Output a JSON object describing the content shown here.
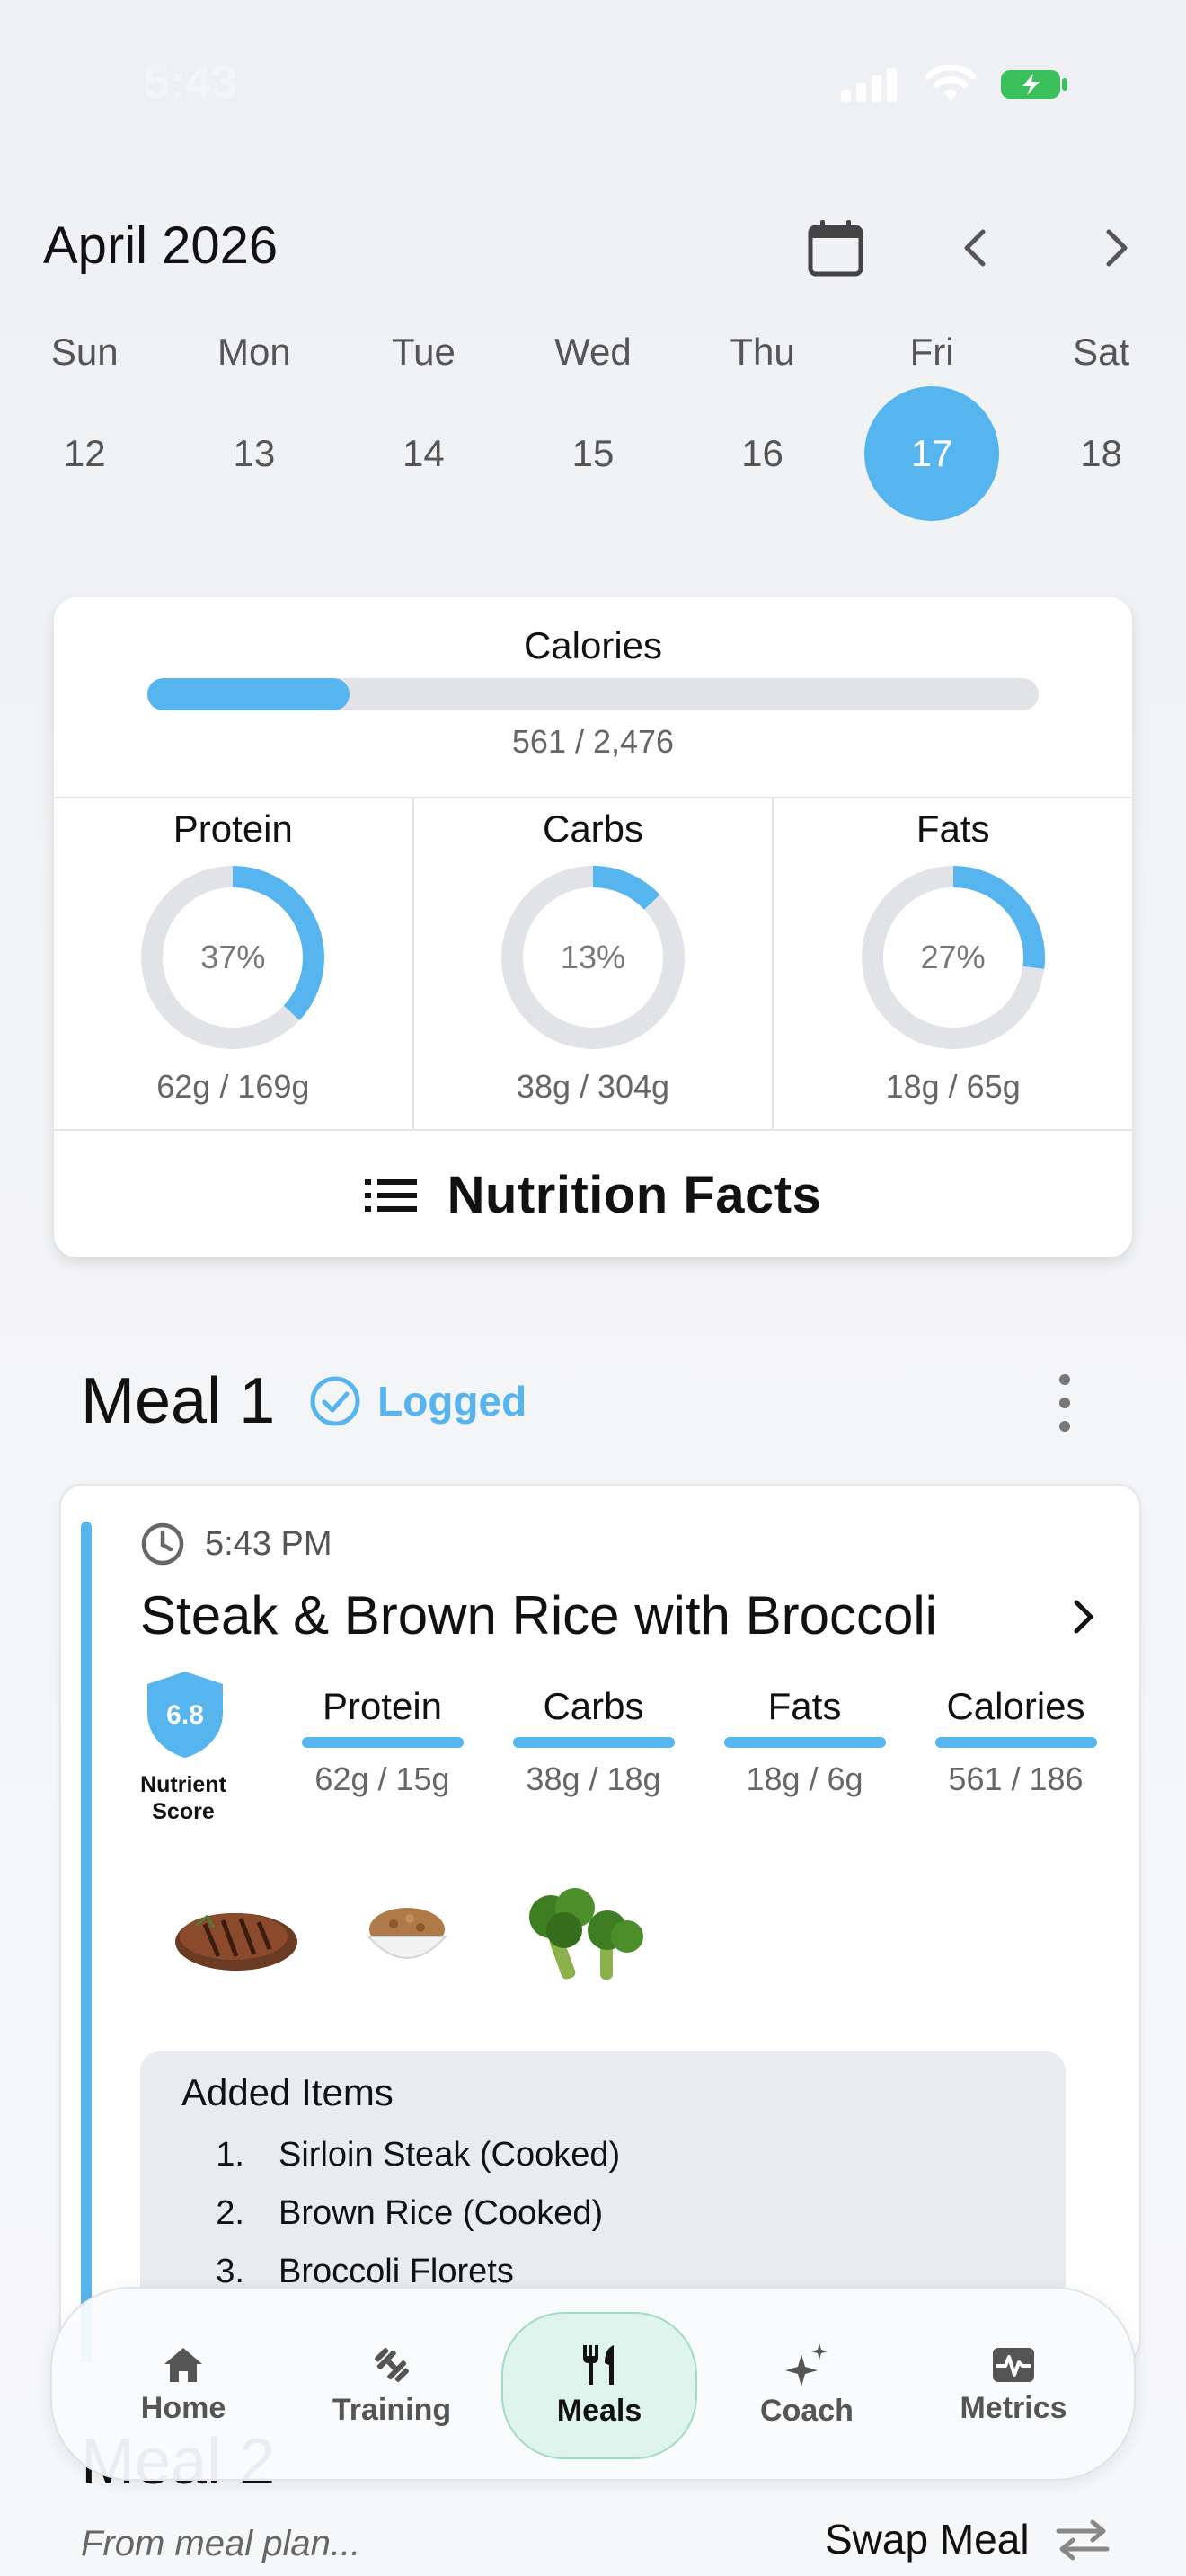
{
  "status": {
    "time": "5:43"
  },
  "calendar": {
    "month": "April 2026",
    "weekdays": [
      "Sun",
      "Mon",
      "Tue",
      "Wed",
      "Thu",
      "Fri",
      "Sat"
    ],
    "days": [
      "12",
      "13",
      "14",
      "15",
      "16",
      "17",
      "18"
    ],
    "selected_day": "17"
  },
  "summary": {
    "calories_title": "Calories",
    "calories_value": "561 / 2,476",
    "calories_progress": 0.227,
    "macros": [
      {
        "name": "Protein",
        "percent_label": "37%",
        "percent": 37,
        "amount": "62g / 169g"
      },
      {
        "name": "Carbs",
        "percent_label": "13%",
        "percent": 13,
        "amount": "38g / 304g"
      },
      {
        "name": "Fats",
        "percent_label": "27%",
        "percent": 27,
        "amount": "18g / 65g"
      }
    ],
    "facts_label": "Nutrition Facts"
  },
  "meal1": {
    "title": "Meal 1",
    "status": "Logged",
    "time": "5:43 PM",
    "name": "Steak & Brown Rice with Broccoli",
    "score": "6.8",
    "score_label_line1": "Nutrient",
    "score_label_line2": "Score",
    "macros": [
      {
        "name": "Protein",
        "value": "62g / 15g"
      },
      {
        "name": "Carbs",
        "value": "38g / 18g"
      },
      {
        "name": "Fats",
        "value": "18g / 6g"
      },
      {
        "name": "Calories",
        "value": "561 / 186"
      }
    ],
    "added_title": "Added Items",
    "items": [
      {
        "idx": "1.",
        "name": "Sirloin Steak (Cooked)"
      },
      {
        "idx": "2.",
        "name": "Brown Rice (Cooked)"
      },
      {
        "idx": "3.",
        "name": "Broccoli Florets"
      }
    ]
  },
  "meal2": {
    "title": "Meal 2",
    "subtitle": "From meal plan...",
    "swap_label": "Swap Meal"
  },
  "tabs": [
    {
      "label": "Home",
      "icon": "home-icon"
    },
    {
      "label": "Training",
      "icon": "dumbbell-icon"
    },
    {
      "label": "Meals",
      "icon": "fork-knife-icon"
    },
    {
      "label": "Coach",
      "icon": "sparkle-icon"
    },
    {
      "label": "Metrics",
      "icon": "pulse-icon"
    }
  ],
  "colors": {
    "accent": "#56b4ef",
    "ring_track": "#e2e3e6",
    "tab_active_bg": "#dff4ec"
  }
}
